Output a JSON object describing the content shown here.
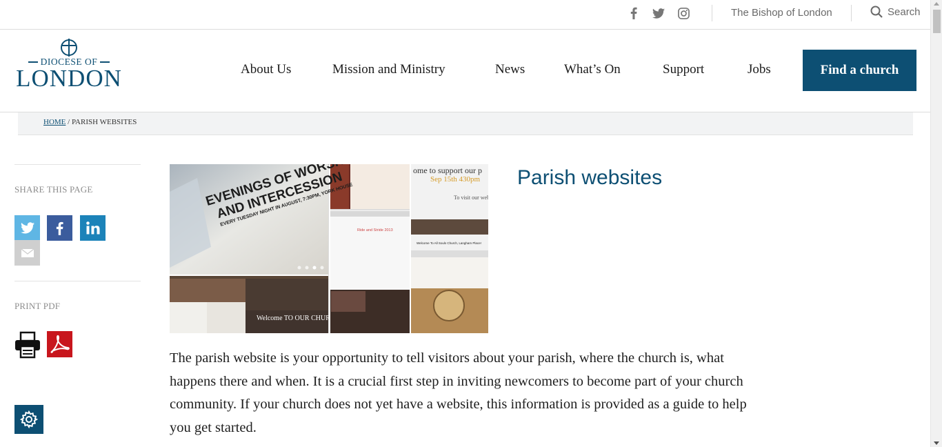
{
  "utility": {
    "social": [
      {
        "name": "facebook-icon"
      },
      {
        "name": "twitter-icon"
      },
      {
        "name": "instagram-icon"
      }
    ],
    "bishop_link": "The Bishop of London",
    "search_label": "Search"
  },
  "logo": {
    "line1": "DIOCESE OF",
    "line2": "LONDON"
  },
  "nav": {
    "items": [
      {
        "label": "About Us"
      },
      {
        "label": "Mission and Ministry"
      },
      {
        "label": "News"
      },
      {
        "label": "What’s On"
      },
      {
        "label": "Support"
      },
      {
        "label": "Jobs"
      }
    ],
    "cta_label": "Find a church"
  },
  "breadcrumb": {
    "home": "HOME",
    "separator": " / ",
    "current": "PARISH WEBSITES"
  },
  "sidebar": {
    "share_label": "SHARE THIS PAGE",
    "print_label": "PRINT PDF"
  },
  "hero": {
    "headline_1": "EVENINGS OF WORSHIP",
    "headline_2": "AND INTERCESSION",
    "headline_3": "EVERY TUESDAY NIGHT IN AUGUST, 7:30PM, YORK HOUSE",
    "snippet_support": "ome to support our p",
    "snippet_date": "Sep 15th 430pm",
    "snippet_visit": "To visit our web",
    "snippet_welcome_center": "Welcome To All Souls Church, Langham Place!",
    "snippet_welcome_bottom": "Welcome TO OUR CHUR",
    "snippet_ride": "Ride and Stride 2013"
  },
  "page": {
    "title": "Parish websites",
    "intro": "The parish website is your opportunity to tell visitors about your parish, where the church is, what happens there and when. It is a crucial first step in inviting newcomers to become part of your church community. If your church does not yet have a website, this information is provided as a guide to help you get started."
  },
  "colors": {
    "brand": "#0d4f73",
    "twitter": "#5fb6e4",
    "facebook": "#3b5c9d",
    "linkedin": "#1c83b9",
    "email": "#cfcfcf",
    "pdf": "#c8161d"
  }
}
